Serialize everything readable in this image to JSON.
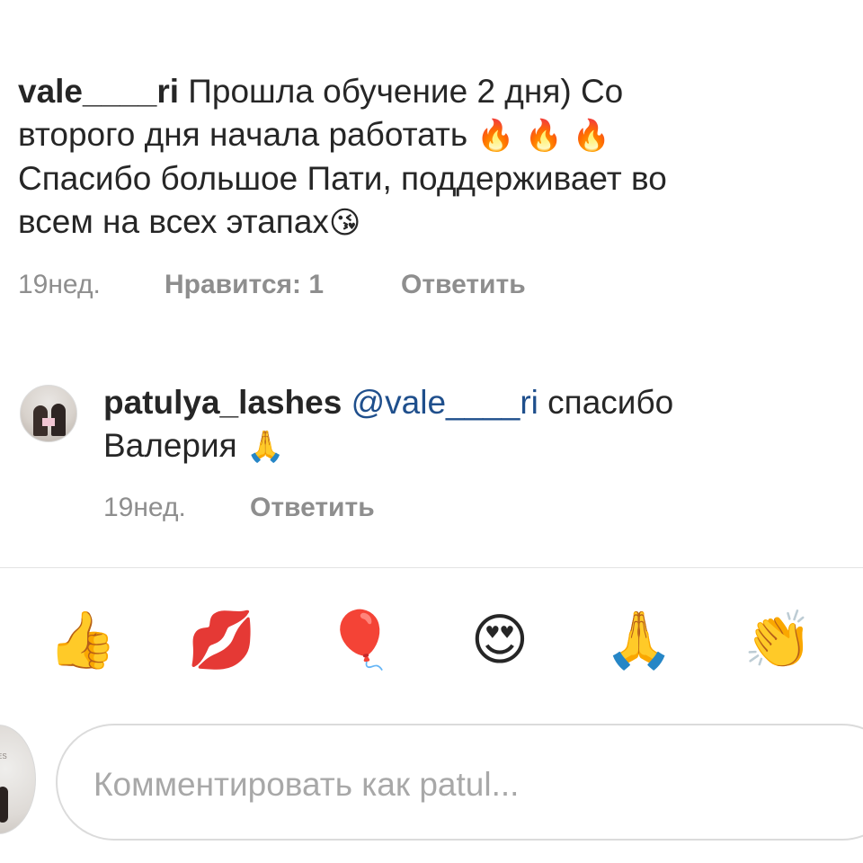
{
  "comments": [
    {
      "username": "vale____ri",
      "text_line1": "Прошла обучение 2 дня)  Со",
      "text_line2": "второго дня начала работать",
      "line2_emojis": "🔥 🔥 🔥",
      "text_line3": "Спасибо большое Пати, поддерживает во",
      "text_line4": "всем на всех этапах",
      "line4_emoji": "😘",
      "time": "19нед.",
      "likes": "Нравится: 1",
      "reply": "Ответить"
    },
    {
      "username": "patulya_lashes",
      "mention": "@vale____ri",
      "text_line1_tail": "спасибо",
      "text_line2": "Валерия",
      "line2_emoji": "🙏",
      "time": "19нед.",
      "reply": "Ответить"
    }
  ],
  "quick_reactions": [
    {
      "emoji": "👍",
      "icon": "thumbs-up-icon"
    },
    {
      "emoji": "💋",
      "icon": "kiss-mark-icon"
    },
    {
      "emoji": "🎈",
      "icon": "balloon-icon"
    },
    {
      "emoji": "😍",
      "icon": "heart-eyes-icon"
    },
    {
      "emoji": "🙏",
      "icon": "folded-hands-icon"
    },
    {
      "emoji": "👏",
      "icon": "clapping-hands-icon"
    }
  ],
  "comment_input": {
    "placeholder": "Комментировать как patul..."
  },
  "colors": {
    "text": "#262626",
    "meta": "#8e8e8e",
    "mention": "#1f4f8c",
    "divider": "#e3e3e3"
  }
}
